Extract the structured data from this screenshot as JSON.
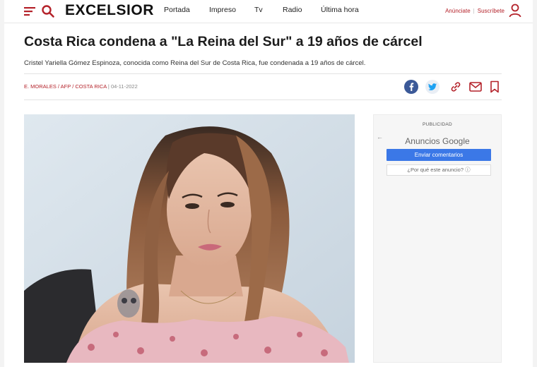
{
  "header": {
    "logo": "EXCELSIOR",
    "nav": [
      "Portada",
      "Impreso",
      "Tv",
      "Radio",
      "Última hora"
    ],
    "anunciate": "Anúnciate",
    "separator": "|",
    "suscribete": "Suscríbete"
  },
  "article": {
    "headline": "Costa Rica condena a \"La Reina del Sur\" a 19 años de cárcel",
    "lede": "Cristel Yariella Gómez Espinoza, conocida como Reina del Sur de Costa Rica, fue condenada a 19 años de cárcel.",
    "byline": "E. MORALES / AFP / COSTA RICA",
    "byline_sep": " | ",
    "date": "04-11-2022"
  },
  "ad": {
    "label": "PUBLICIDAD",
    "back": "←",
    "title": "Anuncios Google",
    "send": "Enviar comentarios",
    "why": "¿Por qué este anuncio? ⓘ"
  },
  "colors": {
    "brand_red": "#b4222a",
    "facebook": "#3b5998",
    "ad_button": "#3b78e7"
  }
}
